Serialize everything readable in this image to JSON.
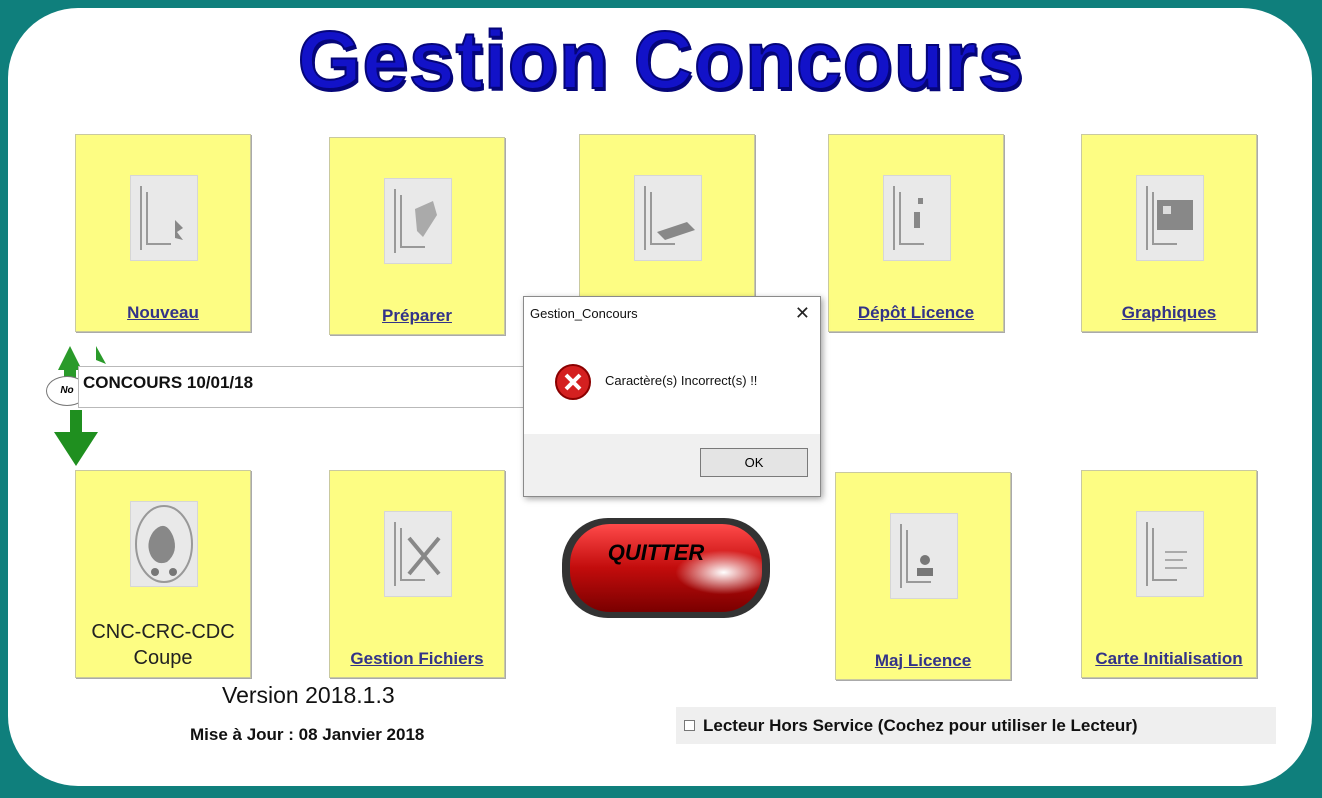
{
  "app": {
    "title": "Gestion Concours"
  },
  "tiles_top": [
    {
      "label": "Nouveau"
    },
    {
      "label": "Préparer"
    },
    {
      "label": ""
    },
    {
      "label": "Dépôt Licence"
    },
    {
      "label": "Graphiques"
    }
  ],
  "tiles_bottom": [
    {
      "label_line1": "CNC-CRC-CDC",
      "label_line2": "Coupe"
    },
    {
      "label": "Gestion Fichiers"
    },
    {
      "label": "Maj Licence"
    },
    {
      "label": "Carte Initialisation"
    }
  ],
  "concours_input": {
    "value": "CONCOURS 10/01/18",
    "badge": "No"
  },
  "quit_button": {
    "label": "QUITTER"
  },
  "footer": {
    "version": "Version 2018.1.3",
    "update": "Mise à Jour : 08 Janvier 2018",
    "reader_checkbox_label": "Lecteur Hors Service (Cochez pour utiliser le Lecteur)"
  },
  "dialog": {
    "title": "Gestion_Concours",
    "message": "Caractère(s) Incorrect(s) !!",
    "ok_label": "OK",
    "close_icon": "close-icon",
    "error_icon": "error-icon"
  },
  "colors": {
    "background": "#0f7f7c",
    "tile": "#fdfd83",
    "title": "#1212c8",
    "quit": "#cc1010"
  }
}
